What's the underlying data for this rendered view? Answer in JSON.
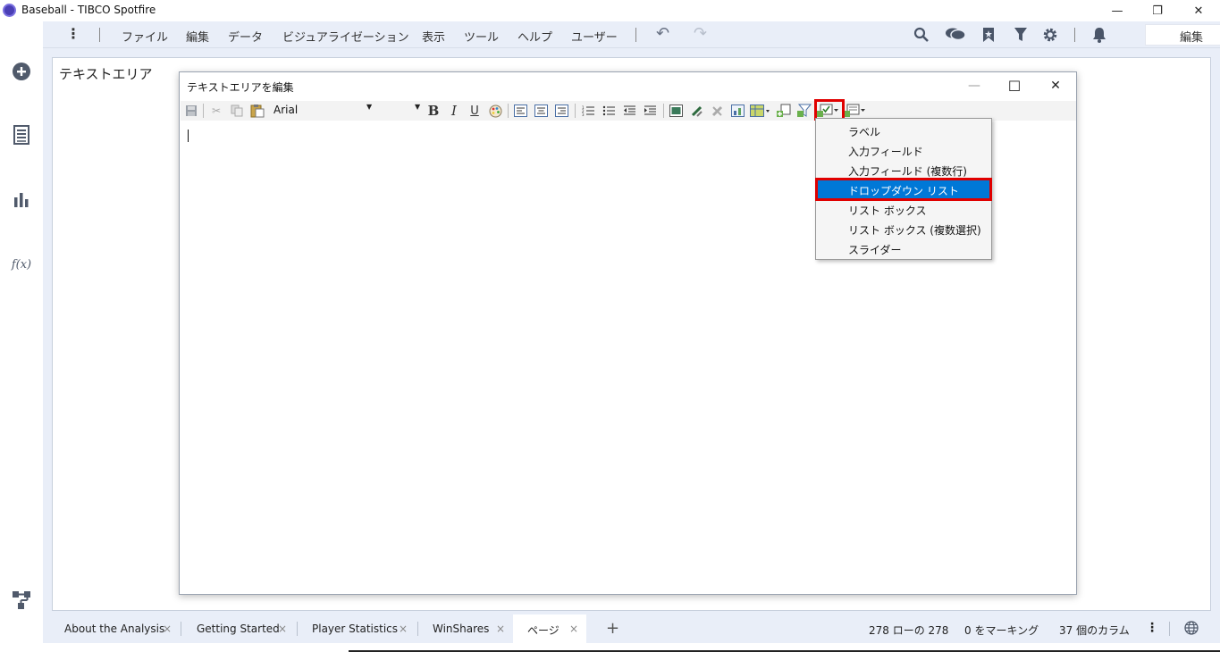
{
  "window": {
    "title": "Baseball - TIBCO Spotfire",
    "minimize": "—",
    "restore": "❐",
    "close": "✕"
  },
  "menu": {
    "more": "⋮",
    "items": [
      "ファイル",
      "編集",
      "データ",
      "ビジュアライゼーション",
      "表示",
      "ツール",
      "ヘルプ",
      "ユーザー"
    ],
    "undo": "↶",
    "redo": "↷",
    "mode_value": "編集",
    "mode_chevron": "⌄",
    "icons": [
      "search-icon",
      "comments-icon",
      "bookmark-icon",
      "filter-icon",
      "gear-icon",
      "bell-icon"
    ]
  },
  "sidebar": {
    "icons": [
      "add-circle-icon",
      "data-table-icon",
      "bar-chart-icon",
      "function-icon",
      "flow-icon"
    ],
    "fx": "f(x)"
  },
  "visualization": {
    "title": "テキストエリア"
  },
  "dialog": {
    "title": "テキストエリアを編集",
    "minimize": "—",
    "maximize": "☐",
    "close": "✕",
    "font_name": "Arial",
    "bold": "B",
    "italic": "I",
    "underline": "U"
  },
  "dropdown": {
    "items": [
      "ラベル",
      "入力フィールド",
      "入力フィールド (複数行)",
      "ドロップダウン リスト",
      "リスト ボックス",
      "リスト ボックス (複数選択)",
      "スライダー"
    ],
    "selected": "ドロップダウン リスト"
  },
  "tabs": [
    {
      "label": "About the Analysis",
      "close": "×"
    },
    {
      "label": "Getting Started",
      "close": "×"
    },
    {
      "label": "Player Statistics",
      "close": "×"
    },
    {
      "label": "WinShares",
      "close": "×"
    },
    {
      "label": "ページ",
      "close": "×"
    }
  ],
  "add_page": "+",
  "status": {
    "rows": "278 ローの 278",
    "marked": "0 をマーキング",
    "columns": "37 個のカラム"
  },
  "colors": {
    "accent": "#0078d7",
    "highlight_border": "#e00000",
    "chrome": "#e9eef8"
  }
}
